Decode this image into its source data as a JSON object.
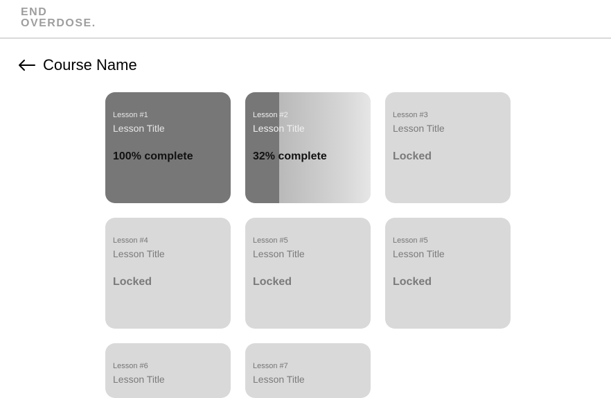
{
  "header": {
    "logo_line1": "END",
    "logo_line2": "OVERDOSE."
  },
  "page": {
    "title": "Course Name"
  },
  "icons": {
    "back": "arrow-left-icon"
  },
  "colors": {
    "complete_fill": "#777777",
    "card_background": "#d9d9d9",
    "header_border": "#d9d9d9"
  },
  "lessons": [
    {
      "number": "Lesson #1",
      "title": "Lesson Title",
      "status": "100% complete",
      "progress": 1.0
    },
    {
      "number": "Lesson #2",
      "title": "Lesson Title",
      "status": "32% complete",
      "progress": 0.32
    },
    {
      "number": "Lesson #3",
      "title": "Lesson Title",
      "status": "Locked"
    },
    {
      "number": "Lesson #4",
      "title": "Lesson Title",
      "status": "Locked"
    },
    {
      "number": "Lesson #5",
      "title": "Lesson Title",
      "status": "Locked"
    },
    {
      "number": "Lesson #5",
      "title": "Lesson Title",
      "status": "Locked"
    },
    {
      "number": "Lesson #6",
      "title": "Lesson Title",
      "status": ""
    },
    {
      "number": "Lesson #7",
      "title": "Lesson Title",
      "status": ""
    }
  ]
}
